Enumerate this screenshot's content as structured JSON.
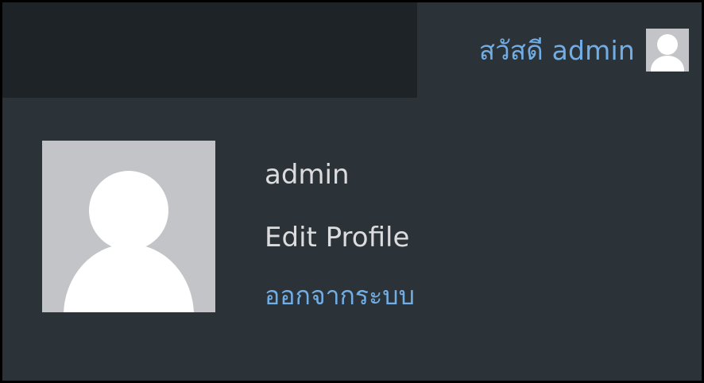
{
  "topbar": {
    "greeting": "สวัสดี admin",
    "avatar_icon": "user-avatar-icon"
  },
  "profile": {
    "avatar_icon": "user-avatar-icon",
    "username": "admin",
    "edit_profile": "Edit Profile",
    "logout": "ออกจากระบบ"
  },
  "colors": {
    "toolbar_bg": "#1d2327",
    "menu_bg": "#2c3338",
    "link_blue": "#72aee6",
    "text_light": "#dcdcde",
    "avatar_gray": "#c3c4c7"
  }
}
